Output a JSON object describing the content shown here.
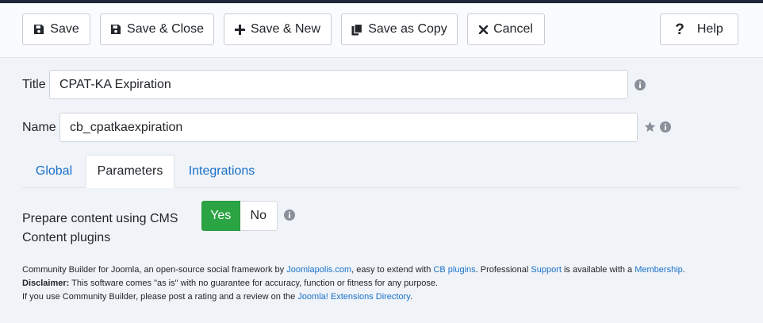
{
  "toolbar": {
    "save": "Save",
    "save_close": "Save & Close",
    "save_new": "Save & New",
    "save_copy": "Save as Copy",
    "cancel": "Cancel",
    "help": "Help"
  },
  "form": {
    "title_label": "Title",
    "title_value": "CPAT-KA Expiration",
    "name_label": "Name",
    "name_value": "cb_cpatkaexpiration"
  },
  "tabs": [
    {
      "label": "Global",
      "active": false
    },
    {
      "label": "Parameters",
      "active": true
    },
    {
      "label": "Integrations",
      "active": false
    }
  ],
  "parameters": {
    "prepare_label_line1": "Prepare content using CMS",
    "prepare_label_line2": "Content plugins",
    "yes": "Yes",
    "no": "No",
    "selected": "Yes"
  },
  "footer": {
    "l1_a": "Community Builder for Joomla, an open-source social framework by ",
    "l1_link1": "Joomlapolis.com",
    "l1_b": ", easy to extend with ",
    "l1_link2": "CB plugins",
    "l1_c": ". Professional ",
    "l1_link3": "Support",
    "l1_d": " is available with a ",
    "l1_link4": "Membership",
    "l1_e": ".",
    "l2_bold": "Disclaimer:",
    "l2_text": " This software comes \"as is\" with no guarantee for accuracy, function or fitness for any purpose.",
    "l3_text": "If you use Community Builder, please post a rating and a review on the ",
    "l3_link": "Joomla! Extensions Directory",
    "l3_end": "."
  },
  "colors": {
    "accent": "#1b70c8",
    "yes_green": "#2ba444",
    "topbar": "#1e2738"
  }
}
